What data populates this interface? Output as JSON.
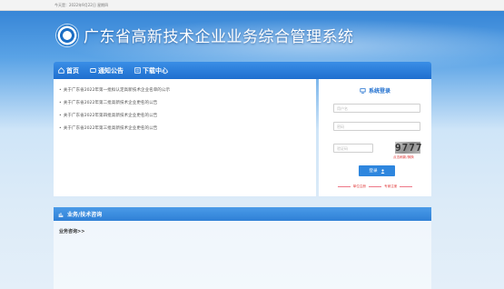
{
  "topbar": {
    "date_text": "今天是：2022年9月22日 星期四"
  },
  "header": {
    "title": "广东省高新技术企业业务综合管理系统"
  },
  "nav": {
    "items": [
      {
        "label": "首页",
        "icon": "home-icon"
      },
      {
        "label": "通知公告",
        "icon": "notice-icon"
      },
      {
        "label": "下载中心",
        "icon": "download-icon"
      }
    ]
  },
  "news": {
    "items": [
      "关于广东省2022年第一批拟认定高新技术企业名单的公示",
      "关于广东省2022年第二批高新技术企业更名的公告",
      "关于广东省2022年第四批高新技术企业更名的公告",
      "关于广东省2022年第三批高新技术企业更名的公告"
    ]
  },
  "login": {
    "title": "系统登录",
    "username_placeholder": "用户名",
    "password_placeholder": "密码",
    "captcha_placeholder": "验证码",
    "captcha_code": "9777",
    "refresh_text": "点击刷新/换换",
    "button_label": "登录",
    "link_unit_register": "单位注册",
    "link_expert_register": "专家注册"
  },
  "consult": {
    "title": "业务/技术咨询",
    "label": "业务咨询>>"
  },
  "colors": {
    "primary": "#1f6fcf",
    "accent_red": "#e03a3a"
  }
}
